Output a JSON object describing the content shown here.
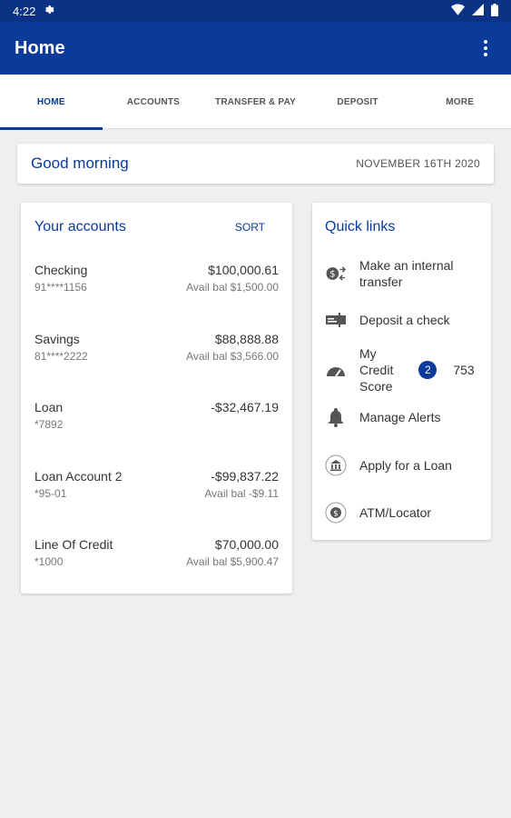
{
  "status_bar": {
    "time": "4:22"
  },
  "app_bar": {
    "title": "Home"
  },
  "tabs": [
    {
      "label": "HOME",
      "active": true
    },
    {
      "label": "ACCOUNTS"
    },
    {
      "label": "TRANSFER & PAY"
    },
    {
      "label": "DEPOSIT"
    },
    {
      "label": "MORE"
    }
  ],
  "greeting": {
    "text": "Good morning",
    "date": "NOVEMBER 16TH 2020"
  },
  "accounts": {
    "title": "Your accounts",
    "sort_label": "SORT",
    "items": [
      {
        "name": "Checking",
        "number": "91****1156",
        "balance": "$100,000.61",
        "avail": "Avail bal $1,500.00"
      },
      {
        "name": "Savings",
        "number": "81****2222",
        "balance": "$88,888.88",
        "avail": "Avail bal $3,566.00"
      },
      {
        "name": "Loan",
        "number": "*7892",
        "balance": "-$32,467.19",
        "avail": ""
      },
      {
        "name": "Loan Account 2",
        "number": "*95-01",
        "balance": "-$99,837.22",
        "avail": "Avail bal -$9.11"
      },
      {
        "name": "Line Of Credit",
        "number": "*1000",
        "balance": "$70,000.00",
        "avail": "Avail bal $5,900.47"
      }
    ]
  },
  "quick_links": {
    "title": "Quick links",
    "items": [
      {
        "label": "Make an internal transfer",
        "icon": "transfer-icon"
      },
      {
        "label": "Deposit a check",
        "icon": "check-icon"
      },
      {
        "label_lines": [
          "My",
          "Credit",
          "Score"
        ],
        "badge": "2",
        "score": "753",
        "icon": "gauge-icon"
      },
      {
        "label": "Manage Alerts",
        "icon": "bell-icon"
      },
      {
        "label": "Apply for a Loan",
        "icon": "bank-icon"
      },
      {
        "label": "ATM/Locator",
        "icon": "atm-icon"
      }
    ]
  },
  "colors": {
    "primary": "#0a3a9a",
    "status_bar": "#0b3385",
    "background": "#efefef"
  }
}
